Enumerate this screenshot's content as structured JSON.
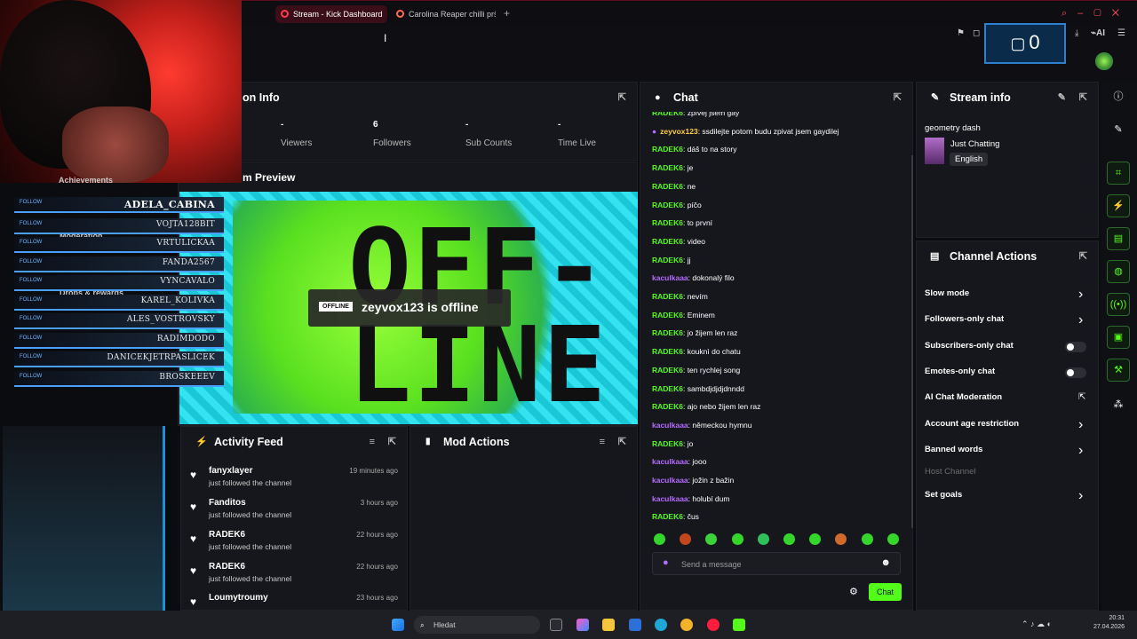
{
  "browser": {
    "tabs": [
      {
        "label": "Stream - Kick Dashboard",
        "active": true
      },
      {
        "label": "Carolina Reaper chilli pršá",
        "active": false
      }
    ],
    "ai_label": "AI"
  },
  "overlay": {
    "counter": "0",
    "followers": [
      {
        "tag": "FOLLOW",
        "name": "ADELA_CABINA"
      },
      {
        "tag": "FOLLOW",
        "name": "VOJTA128BIT"
      },
      {
        "tag": "FOLLOW",
        "name": "VRTULICKAA"
      },
      {
        "tag": "FOLLOW",
        "name": "FANDA2567"
      },
      {
        "tag": "FOLLOW",
        "name": "VYNCAVALO"
      },
      {
        "tag": "FOLLOW",
        "name": "KAREL_KOLIVKA"
      },
      {
        "tag": "FOLLOW",
        "name": "ALES_VOSTROVSKY"
      },
      {
        "tag": "FOLLOW",
        "name": "RADIMDODO"
      },
      {
        "tag": "FOLLOW",
        "name": "DANICEKJETRPASLICEK"
      },
      {
        "tag": "FOLLOW",
        "name": "BROSKEEEV"
      }
    ],
    "ghost_nav": [
      "Achievements",
      "Moderation",
      "Drops & rewards"
    ]
  },
  "session": {
    "title": "on Info",
    "stats": [
      {
        "value": "-",
        "label": "Viewers"
      },
      {
        "value": "6",
        "label": "Followers"
      },
      {
        "value": "-",
        "label": "Sub Counts"
      },
      {
        "value": "-",
        "label": "Time Live"
      }
    ]
  },
  "preview": {
    "title": "m Preview",
    "big_text_1": "OFF-",
    "big_text_2": "LINE",
    "badge": "OFFLINE",
    "status": "zeyvox123 is offline"
  },
  "activity": {
    "title": "Activity Feed",
    "items": [
      {
        "name": "fanyxlayer",
        "sub": "just followed the channel",
        "time": "19 minutes ago"
      },
      {
        "name": "Fanditos",
        "sub": "just followed the channel",
        "time": "3 hours ago"
      },
      {
        "name": "RADEK6",
        "sub": "just followed the channel",
        "time": "22 hours ago"
      },
      {
        "name": "RADEK6",
        "sub": "just followed the channel",
        "time": "22 hours ago"
      },
      {
        "name": "Loumytroumy",
        "sub": "",
        "time": "23 hours ago"
      }
    ]
  },
  "mod_actions": {
    "title": "Mod Actions"
  },
  "chat": {
    "title": "Chat",
    "messages": [
      {
        "user": "RADEK6",
        "text": "zpívej jsem gay",
        "color": "g"
      },
      {
        "user": "zeyvox123",
        "text": "ssdilejte potom budu zpivat jsem gaydilej",
        "color": "y"
      },
      {
        "user": "RADEK6",
        "text": "dáš to na story",
        "color": "g"
      },
      {
        "user": "RADEK6",
        "text": "je",
        "color": "g"
      },
      {
        "user": "RADEK6",
        "text": "ne",
        "color": "g"
      },
      {
        "user": "RADEK6",
        "text": "píčo",
        "color": "g"
      },
      {
        "user": "RADEK6",
        "text": "to první",
        "color": "g"
      },
      {
        "user": "RADEK6",
        "text": "video",
        "color": "g"
      },
      {
        "user": "RADEK6",
        "text": "jj",
        "color": "g"
      },
      {
        "user": "kaculkaaa",
        "text": "dokonalý filo",
        "color": "p"
      },
      {
        "user": "RADEK6",
        "text": "nevím",
        "color": "g"
      },
      {
        "user": "RADEK6",
        "text": "Eminem",
        "color": "g"
      },
      {
        "user": "RADEK6",
        "text": "jo žijem len raz",
        "color": "g"
      },
      {
        "user": "RADEK6",
        "text": "kouknì do chatu",
        "color": "g"
      },
      {
        "user": "RADEK6",
        "text": "ten rychlej song",
        "color": "g"
      },
      {
        "user": "RADEK6",
        "text": "sambdjdjdjdnndd",
        "color": "g"
      },
      {
        "user": "RADEK6",
        "text": "ajo nebo žijem len raz",
        "color": "g"
      },
      {
        "user": "kaculkaaa",
        "text": "německou hymnu",
        "color": "p"
      },
      {
        "user": "RADEK6",
        "text": "jo",
        "color": "g"
      },
      {
        "user": "kaculkaaa",
        "text": "jooo",
        "color": "p"
      },
      {
        "user": "kaculkaaa",
        "text": "jožin z bažin",
        "color": "p"
      },
      {
        "user": "kaculkaaa",
        "text": "holubí dum",
        "color": "p"
      },
      {
        "user": "RADEK6",
        "text": "čus",
        "color": "g"
      }
    ],
    "placeholder": "Send a message",
    "send_label": "Chat"
  },
  "stream_info": {
    "title": "Stream info",
    "stream_title": "geometry dash",
    "category": "Just Chatting",
    "language": "English"
  },
  "channel_actions": {
    "title": "Channel Actions",
    "items": [
      {
        "label": "Slow mode",
        "control": "chevron"
      },
      {
        "label": "Followers-only chat",
        "control": "chevron"
      },
      {
        "label": "Subscribers-only chat",
        "control": "toggle"
      },
      {
        "label": "Emotes-only chat",
        "control": "toggle"
      },
      {
        "label": "AI Chat Moderation",
        "control": "external"
      },
      {
        "label": "Account age restriction",
        "control": "chevron"
      },
      {
        "label": "Banned words",
        "control": "chevron"
      },
      {
        "label": "Host Channel",
        "control": "none"
      },
      {
        "label": "Set goals",
        "control": "chevron"
      }
    ]
  },
  "taskbar": {
    "search_placeholder": "Hledat",
    "time": "20:31",
    "date": "27.04.2026"
  },
  "colors": {
    "accent": "#53fc18",
    "brand_red": "#ff3a4c",
    "overlay_blue": "#4aa0ff"
  }
}
